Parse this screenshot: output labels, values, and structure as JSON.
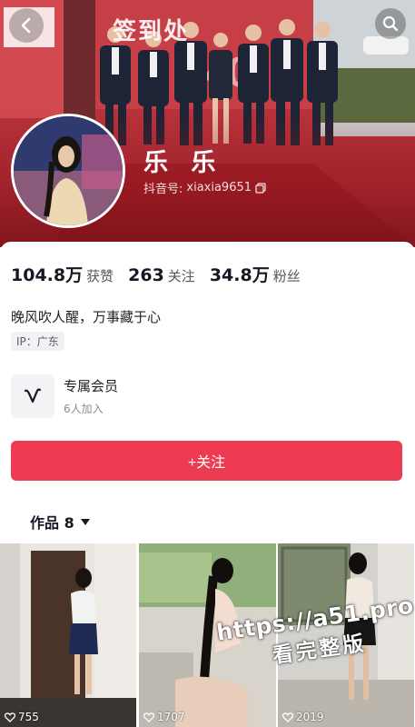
{
  "header": {
    "banner_sign": "签到处",
    "nickname": "乐 乐",
    "douyin_id_label": "抖音号:",
    "douyin_id": "xiaxia9651"
  },
  "stats": [
    {
      "value": "104.8万",
      "label": "获赞"
    },
    {
      "value": "263",
      "label": "关注"
    },
    {
      "value": "34.8万",
      "label": "粉丝"
    }
  ],
  "bio": "晚风吹人醒，万事藏于心",
  "ip_tag": "IP：广东",
  "membership": {
    "title": "专属会员",
    "subtitle": "6人加入"
  },
  "follow_button": "+关注",
  "works_tab": {
    "label": "作品 8"
  },
  "videos": [
    {
      "likes": "755"
    },
    {
      "likes": "1707"
    },
    {
      "likes": "2019"
    }
  ],
  "watermark": {
    "line1": "https://a51.pro",
    "line2": "看完整版"
  },
  "icons": [
    "back-icon",
    "search-icon",
    "copy-icon",
    "member-v-icon",
    "caret-down-icon",
    "heart-icon"
  ],
  "colors": {
    "banner_red": "#b52a33",
    "follow_button": "#ee3b54",
    "text_primary": "#161823"
  }
}
